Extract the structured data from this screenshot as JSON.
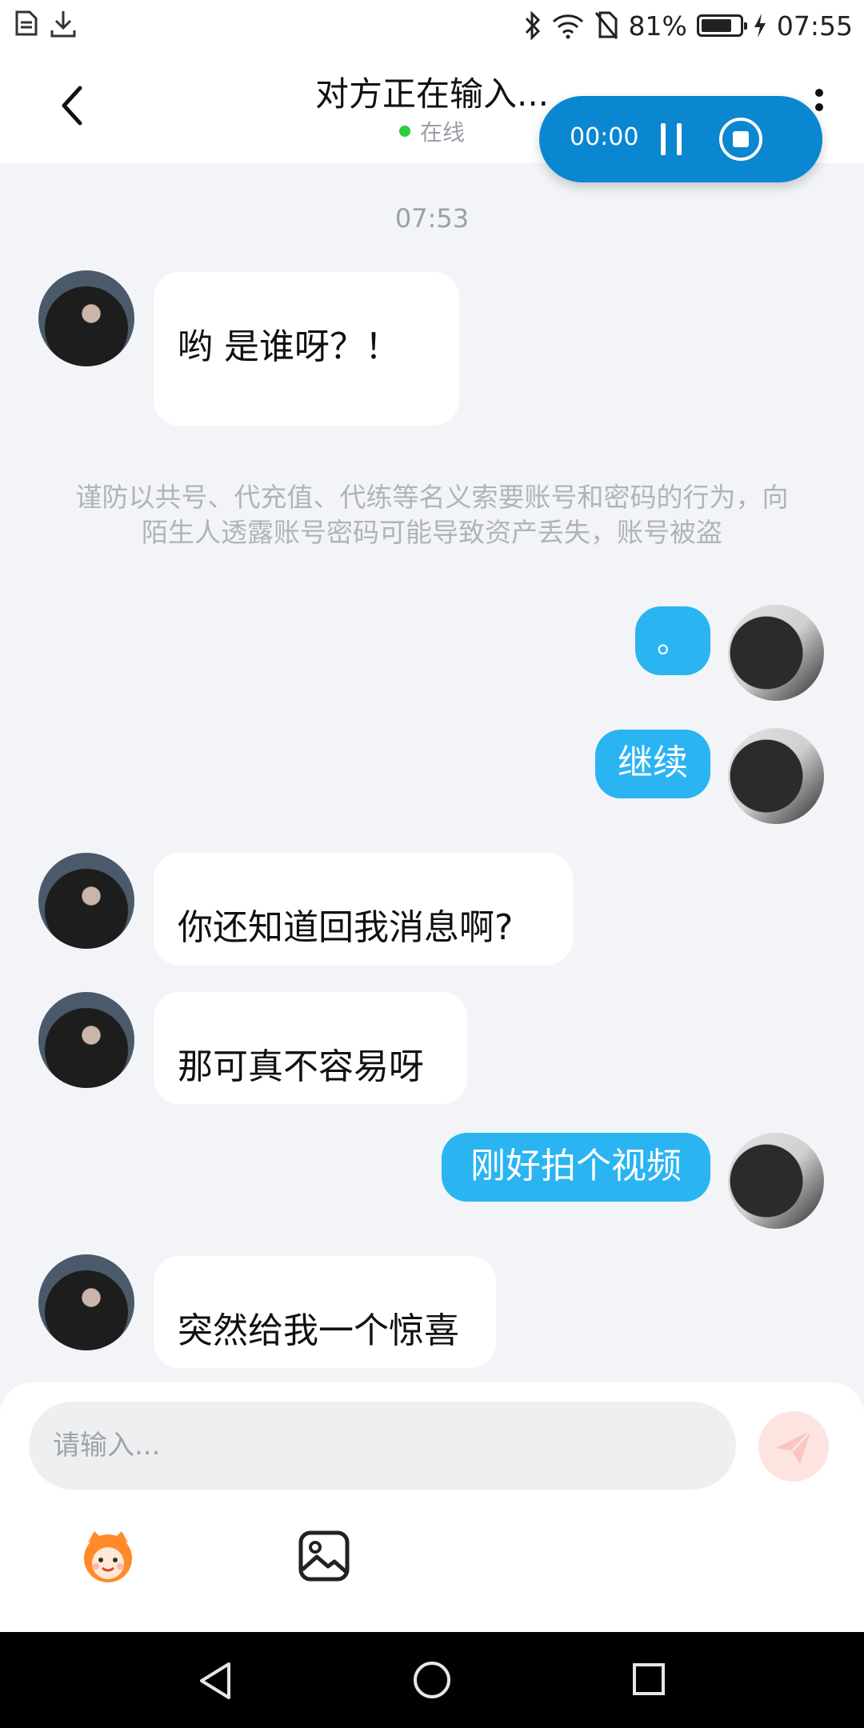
{
  "status_bar": {
    "battery_percent": "81%",
    "battery_level": 0.81,
    "time": "07:55",
    "icons": [
      "document-icon",
      "download-icon",
      "bluetooth-icon",
      "wifi-icon",
      "no-sim-icon",
      "battery-icon",
      "charging-icon"
    ]
  },
  "header": {
    "title": "对方正在输入...",
    "status": "在线",
    "status_color": "#2ecc40"
  },
  "recording": {
    "time": "00:00",
    "bg_color": "#0a87d0"
  },
  "chat": {
    "timestamp": "07:53",
    "notice": "谨防以共号、代充值、代练等名义索要账号和密码的行为，向陌生人透露账号密码可能导致资产丢失，账号被盗",
    "messages": [
      {
        "side": "in",
        "text": "哟   是谁呀？！"
      },
      {
        "side": "out",
        "text": "。"
      },
      {
        "side": "out",
        "text": "继续"
      },
      {
        "side": "in",
        "text": "你还知道回我消息啊?"
      },
      {
        "side": "in",
        "text": "那可真不容易呀"
      },
      {
        "side": "out",
        "text": "刚好拍个视频"
      },
      {
        "side": "in",
        "text": "突然给我一个惊喜"
      }
    ],
    "outgoing_color": "#2bb4f2"
  },
  "composer": {
    "placeholder": "请输入..."
  }
}
